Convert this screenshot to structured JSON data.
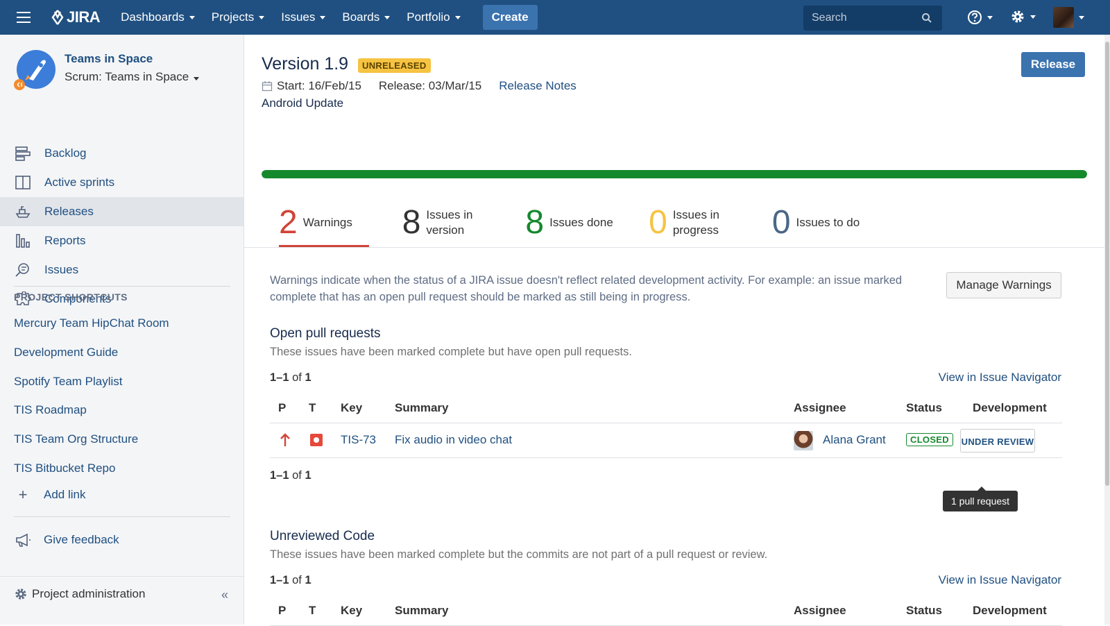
{
  "topbar": {
    "logo_text": "JIRA",
    "nav": [
      "Dashboards",
      "Projects",
      "Issues",
      "Boards",
      "Portfolio"
    ],
    "create_label": "Create",
    "search_placeholder": "Search"
  },
  "sidebar": {
    "project_name": "Teams in Space",
    "board_name": "Scrum: Teams in Space",
    "items": [
      {
        "label": "Backlog",
        "icon": "backlog-icon"
      },
      {
        "label": "Active sprints",
        "icon": "sprints-icon"
      },
      {
        "label": "Releases",
        "icon": "releases-icon"
      },
      {
        "label": "Reports",
        "icon": "reports-icon"
      },
      {
        "label": "Issues",
        "icon": "issues-icon"
      },
      {
        "label": "Components",
        "icon": "components-icon"
      }
    ],
    "active_item": "Releases",
    "shortcuts_heading": "PROJECT SHORTCUTS",
    "shortcuts": [
      "Mercury Team HipChat Room",
      "Development Guide",
      "Spotify Team Playlist",
      "TIS Roadmap",
      "TIS Team Org Structure",
      "TIS Bitbucket Repo"
    ],
    "add_link": "Add link",
    "feedback": "Give feedback",
    "admin": "Project administration",
    "collapse": "«"
  },
  "version": {
    "title": "Version 1.9",
    "status": "UNRELEASED",
    "release_button": "Release",
    "start": "Start: 16/Feb/15",
    "release": "Release: 03/Mar/15",
    "release_notes": "Release Notes",
    "description": "Android Update",
    "progress_done_fraction": 1.0
  },
  "stats": [
    {
      "num": "2",
      "label": "Warnings",
      "color": "#d04437"
    },
    {
      "num": "8",
      "label": "Issues in version",
      "color": "#333333"
    },
    {
      "num": "8",
      "label": "Issues done",
      "color": "#14892c"
    },
    {
      "num": "0",
      "label": "Issues in progress",
      "color": "#f6c342"
    },
    {
      "num": "0",
      "label": "Issues to do",
      "color": "#4a6785"
    }
  ],
  "warnings": {
    "text": "Warnings indicate when the status of a JIRA issue doesn't reflect related development activity. For example: an issue marked complete that has an open pull request should be marked as still being in progress.",
    "manage_button": "Manage Warnings"
  },
  "open_prs": {
    "title": "Open pull requests",
    "subtitle": "These issues have been marked complete but have open pull requests.",
    "count_range": "1–1",
    "count_of": "of",
    "count_total": "1",
    "view_link": "View in Issue Navigator",
    "columns": [
      "P",
      "T",
      "Key",
      "Summary",
      "Assignee",
      "Status",
      "Development"
    ],
    "rows": [
      {
        "key": "TIS-73",
        "summary": "Fix audio in video chat",
        "assignee": "Alana Grant",
        "status": "CLOSED",
        "development": "UNDER REVIEW"
      }
    ],
    "tooltip": "1 pull request"
  },
  "unreviewed": {
    "title": "Unreviewed Code",
    "subtitle": "These issues have been marked complete but the commits are not part of a pull request or review.",
    "count_range": "1–1",
    "count_of": "of",
    "count_total": "1",
    "view_link": "View in Issue Navigator",
    "columns": [
      "P",
      "T",
      "Key",
      "Summary",
      "Assignee",
      "Status",
      "Development"
    ]
  }
}
